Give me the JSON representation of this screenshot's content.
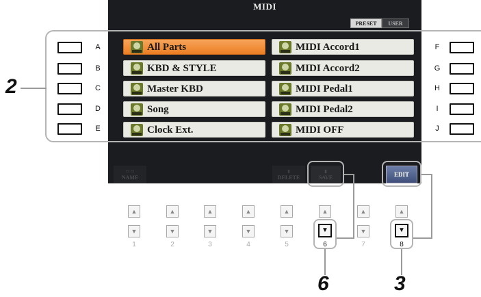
{
  "screen": {
    "title": "MIDI",
    "tabs": [
      "PRESET",
      "USER"
    ]
  },
  "files_left": [
    "All Parts",
    "KBD & STYLE",
    "Master KBD",
    "Song",
    "Clock Ext."
  ],
  "files_right": [
    "MIDI Accord1",
    "MIDI Accord2",
    "MIDI Pedal1",
    "MIDI Pedal2",
    "MIDI OFF"
  ],
  "left_button_labels": [
    "A",
    "B",
    "C",
    "D",
    "E"
  ],
  "right_button_labels": [
    "F",
    "G",
    "H",
    "I",
    "J"
  ],
  "selected_file": "All Parts",
  "bottom_menu": {
    "name": "NAME",
    "delete": "DELETE",
    "save": "SAVE",
    "edit": "EDIT"
  },
  "button_numbers": [
    "1",
    "2",
    "3",
    "4",
    "5",
    "6",
    "7",
    "8"
  ],
  "callouts": {
    "step_2": "2",
    "step_6": "6",
    "step_3": "3"
  },
  "colors": {
    "selected_cell": "#ec7d22",
    "cell": "#e9eae3",
    "lcd": "#1b1c1f",
    "edit_button": "#4a5a85"
  }
}
